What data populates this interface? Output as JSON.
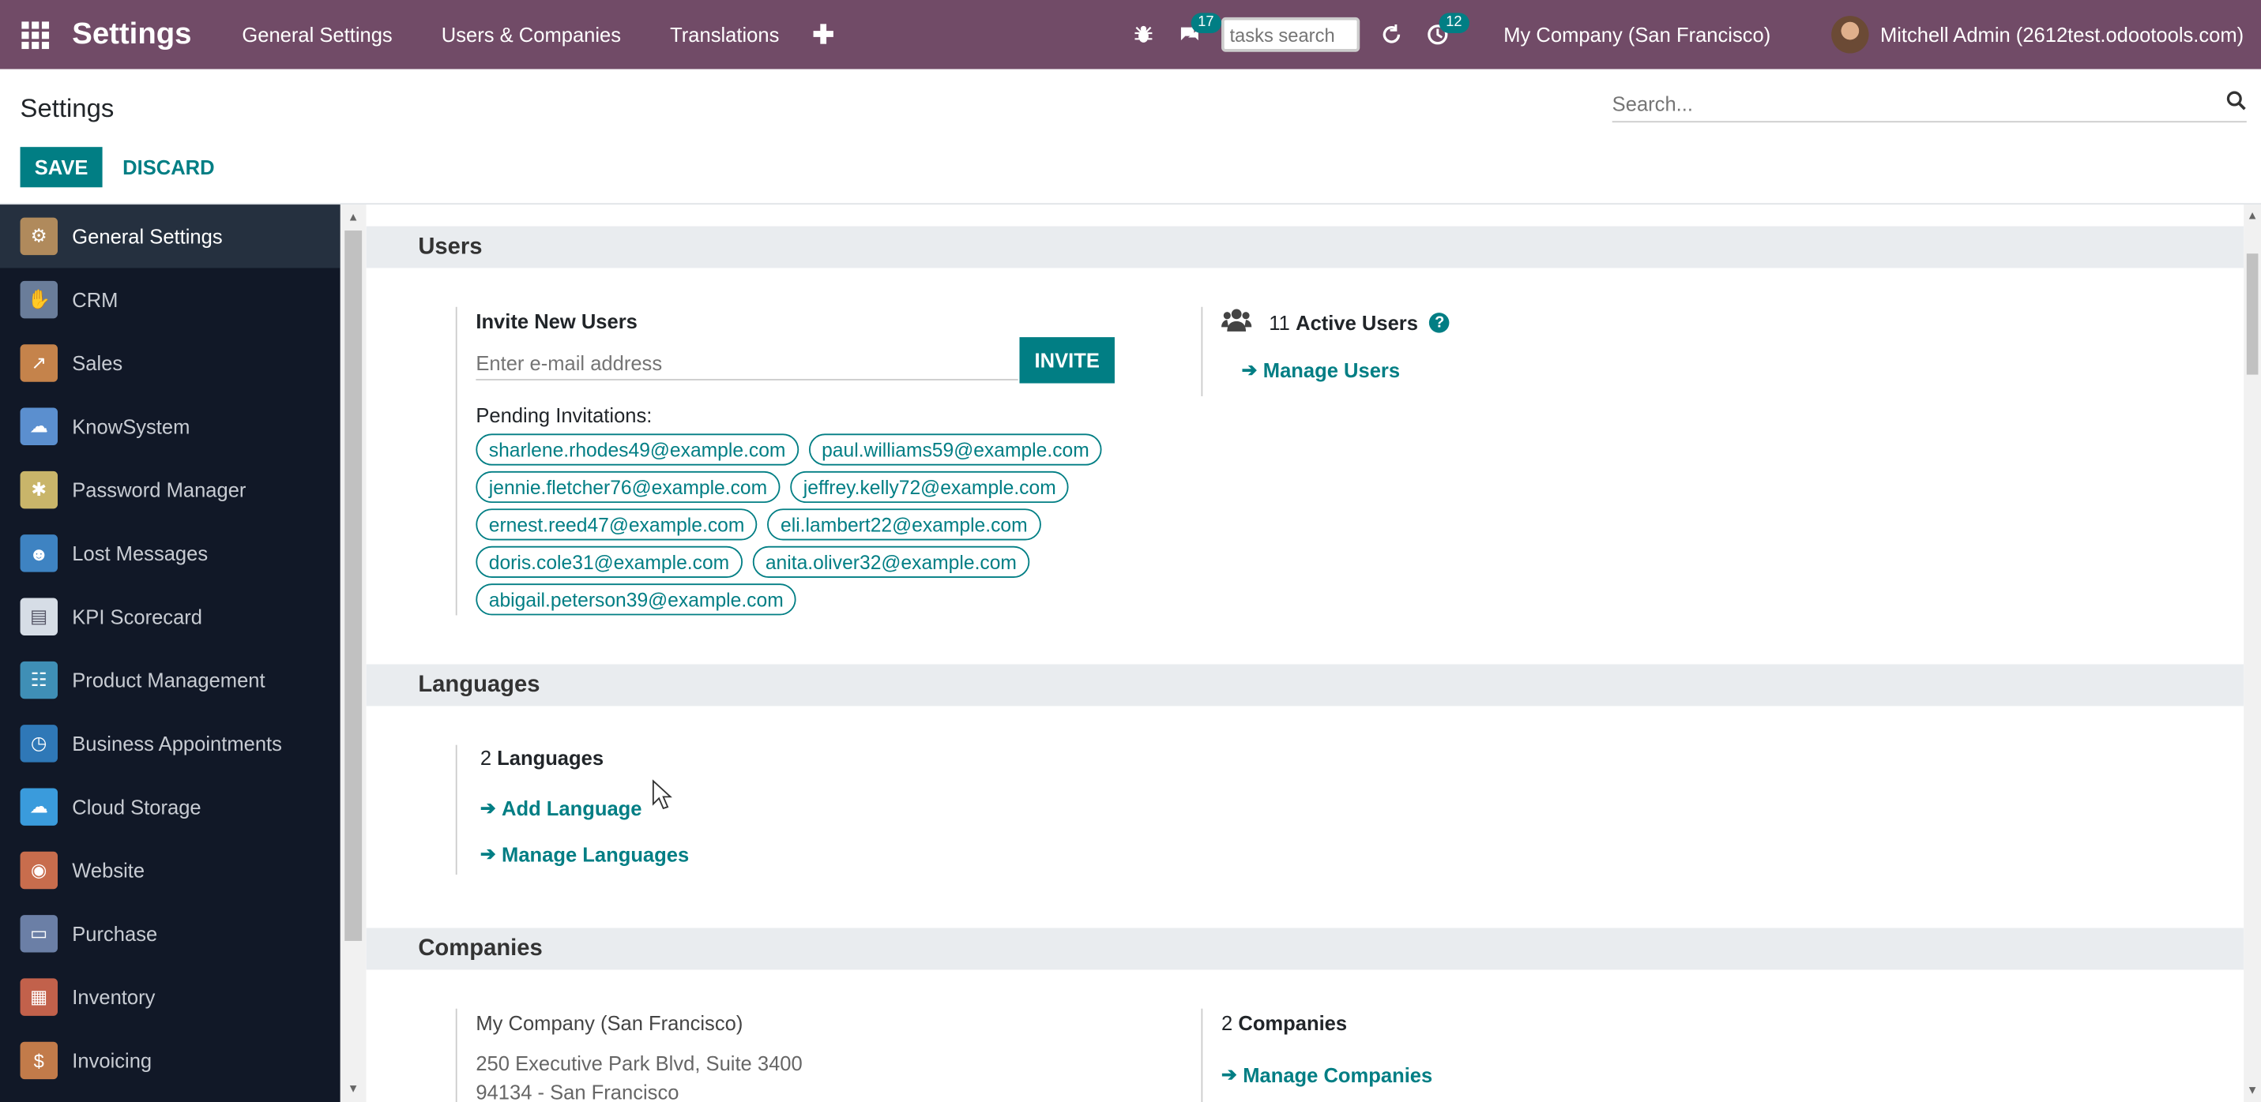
{
  "navbar": {
    "brand": "Settings",
    "menus": [
      "General Settings",
      "Users & Companies",
      "Translations"
    ],
    "chat_count": "17",
    "tasks_search_placeholder": "tasks search",
    "activity_count": "12",
    "company": "My Company (San Francisco)",
    "user": "Mitchell Admin (2612test.odootools.com)"
  },
  "control": {
    "title": "Settings",
    "search_placeholder": "Search...",
    "save": "SAVE",
    "discard": "DISCARD"
  },
  "sidebar": {
    "items": [
      {
        "label": "General Settings",
        "icon": "gear-icon",
        "color": "#b08a5c"
      },
      {
        "label": "CRM",
        "icon": "handshake-icon",
        "color": "#6a7d9a"
      },
      {
        "label": "Sales",
        "icon": "chart-icon",
        "color": "#c5834b"
      },
      {
        "label": "KnowSystem",
        "icon": "brain-icon",
        "color": "#5b8fcf"
      },
      {
        "label": "Password Manager",
        "icon": "key-icon",
        "color": "#c9b56a"
      },
      {
        "label": "Lost Messages",
        "icon": "person-icon",
        "color": "#3e83c2"
      },
      {
        "label": "KPI Scorecard",
        "icon": "paper-icon",
        "color": "#d6dde6"
      },
      {
        "label": "Product Management",
        "icon": "sliders-icon",
        "color": "#3f8fb6"
      },
      {
        "label": "Business Appointments",
        "icon": "clock-icon",
        "color": "#2f78b7"
      },
      {
        "label": "Cloud Storage",
        "icon": "cloud-icon",
        "color": "#3a9bdc"
      },
      {
        "label": "Website",
        "icon": "globe-icon",
        "color": "#c86d4d"
      },
      {
        "label": "Purchase",
        "icon": "card-icon",
        "color": "#6b7fa6"
      },
      {
        "label": "Inventory",
        "icon": "box-icon",
        "color": "#c2614b"
      },
      {
        "label": "Invoicing",
        "icon": "invoice-icon",
        "color": "#c27b4a"
      }
    ]
  },
  "users": {
    "heading": "Users",
    "invite_label": "Invite New Users",
    "email_placeholder": "Enter e-mail address",
    "invite_button": "INVITE",
    "pending_label": "Pending Invitations:",
    "pending": [
      "sharlene.rhodes49@example.com",
      "paul.williams59@example.com",
      "jennie.fletcher76@example.com",
      "jeffrey.kelly72@example.com",
      "ernest.reed47@example.com",
      "eli.lambert22@example.com",
      "doris.cole31@example.com",
      "anita.oliver32@example.com",
      "abigail.peterson39@example.com"
    ],
    "active_count": "11",
    "active_label": "Active Users",
    "manage_users": "Manage Users"
  },
  "languages": {
    "heading": "Languages",
    "count": "2",
    "count_label": "Languages",
    "add": "Add Language",
    "manage": "Manage Languages"
  },
  "companies": {
    "heading": "Companies",
    "name": "My Company (San Francisco)",
    "address1": "250 Executive Park Blvd, Suite 3400",
    "address2": "94134 - San Francisco",
    "count": "2",
    "count_label": "Companies",
    "manage": "Manage Companies"
  }
}
